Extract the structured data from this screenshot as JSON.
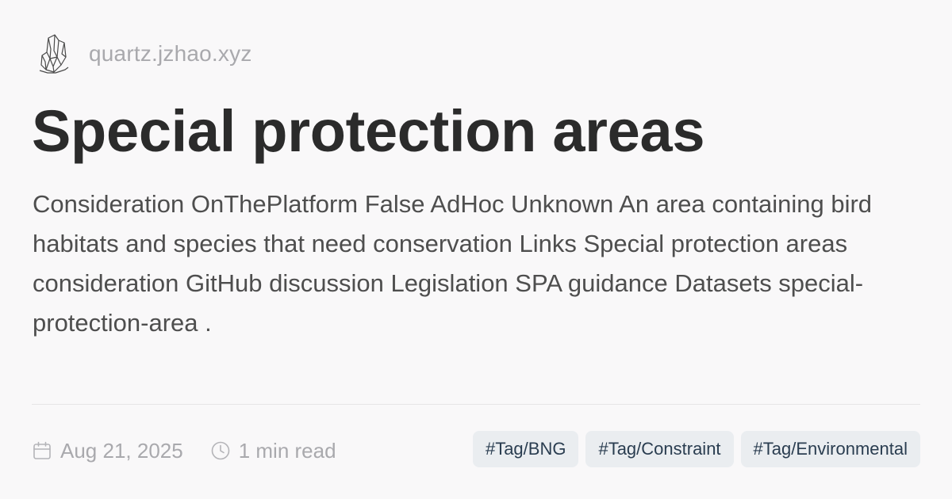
{
  "site": {
    "logo_icon": "crystal-logo-icon",
    "url": "quartz.jzhao.xyz"
  },
  "page": {
    "title": "Special protection areas",
    "description": "Consideration OnThePlatform False AdHoc Unknown An area containing bird habitats and species that need conservation Links Special protection areas consideration GitHub discussion Legislation SPA guidance Datasets special-protection-area ."
  },
  "meta": {
    "date_icon": "calendar-icon",
    "date": "Aug 21, 2025",
    "reading_time_icon": "clock-icon",
    "reading_time": "1 min read"
  },
  "tags": [
    "#Tag/BNG",
    "#Tag/Constraint",
    "#Tag/Environmental"
  ],
  "colors": {
    "background": "#f9f8f9",
    "title": "#2b2b2b",
    "body_text": "#4e4e4e",
    "muted": "#a9a9ad",
    "tag_background": "#eaedf0",
    "tag_text": "#2a3d50"
  }
}
